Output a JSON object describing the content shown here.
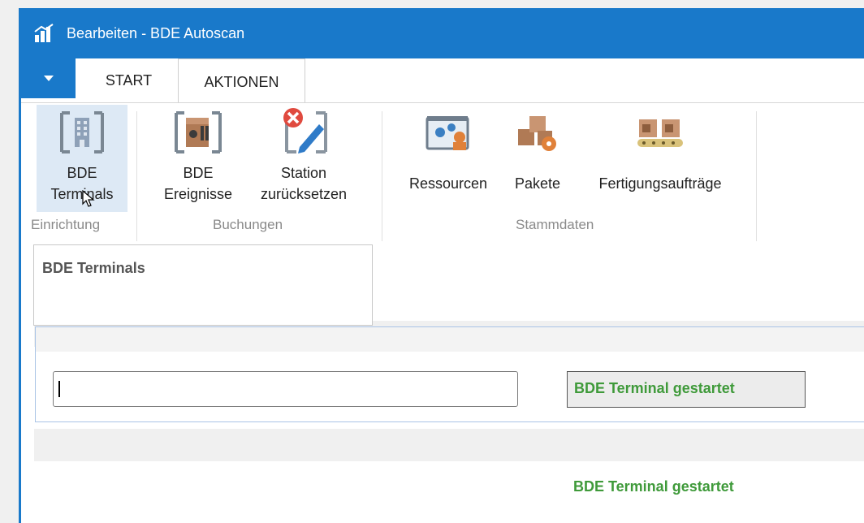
{
  "window": {
    "title": "Bearbeiten - BDE Autoscan",
    "accent_color": "#1979ca",
    "app_icon": "chart-bar-icon"
  },
  "tabs": {
    "menu_icon": "caret-down-icon",
    "start": "START",
    "aktionen": "AKTIONEN",
    "active": "AKTIONEN"
  },
  "ribbon": {
    "groups": [
      {
        "label": "Einrichtung",
        "buttons": [
          {
            "line1": "BDE",
            "line2": "Terminals",
            "icon": "terminal-building-icon"
          }
        ]
      },
      {
        "label": "Buchungen",
        "buttons": [
          {
            "line1": "BDE",
            "line2": "Ereignisse",
            "icon": "event-tools-icon"
          },
          {
            "line1": "Station",
            "line2": "zurücksetzen",
            "icon": "reset-station-icon"
          }
        ]
      },
      {
        "label": "Stammdaten",
        "buttons": [
          {
            "line1": "Ressourcen",
            "icon": "resources-icon"
          },
          {
            "line1": "Pakete",
            "icon": "packages-icon"
          },
          {
            "line1": "Fertigungsaufträge",
            "icon": "production-orders-icon"
          }
        ]
      }
    ]
  },
  "tooltip": {
    "title": "BDE Terminals"
  },
  "form": {
    "scan_input_value": "",
    "status_label": "BDE Terminal gestartet",
    "status_color": "#3f9a3a"
  },
  "status_message": "BDE Terminal gestartet"
}
